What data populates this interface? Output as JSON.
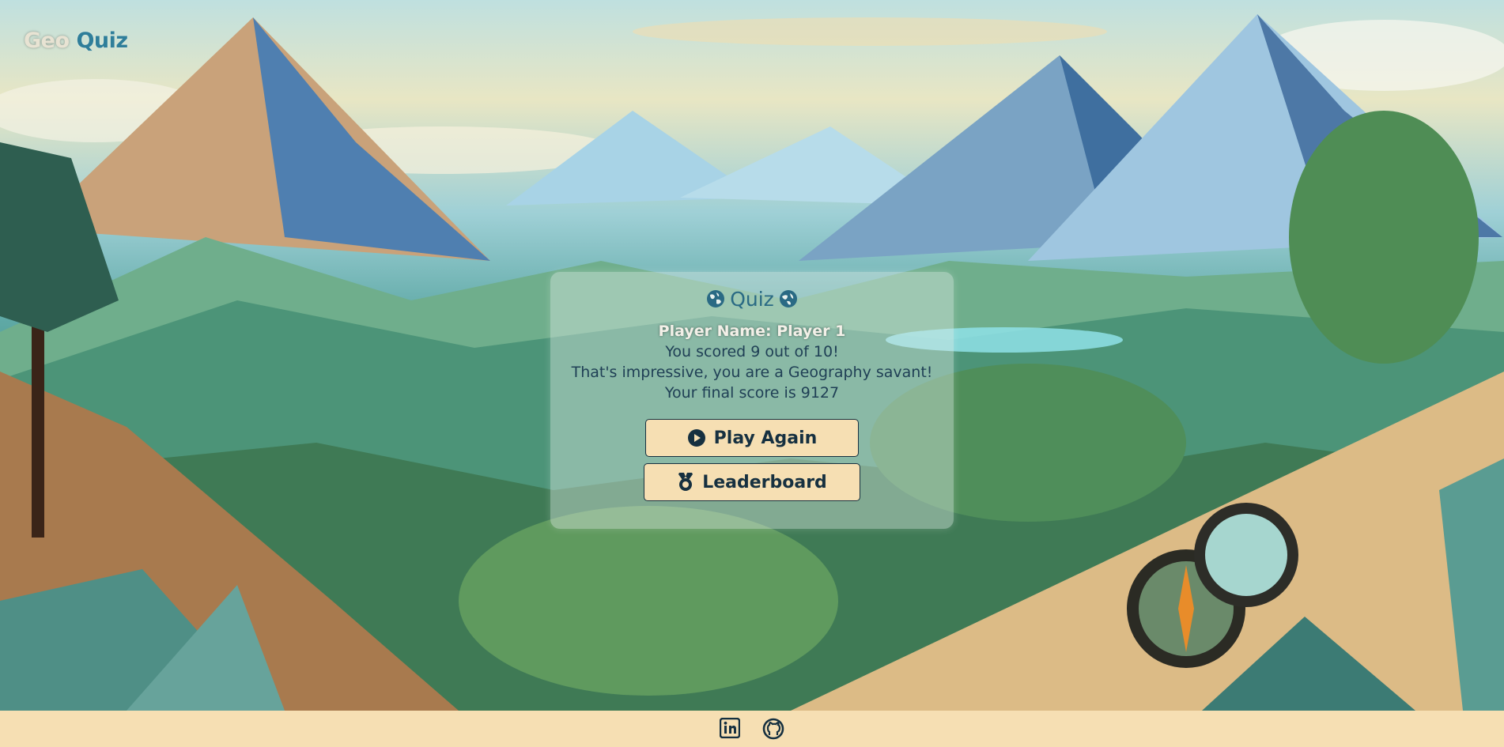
{
  "brand": {
    "geo": "Geo",
    "quiz": "Quiz"
  },
  "card": {
    "title": "Quiz",
    "player_name": "Player Name: Player 1",
    "score_line": "You scored 9 out of 10!",
    "message": "That's impressive, you are a Geography savant!",
    "final_score": "Your final score is 9127"
  },
  "buttons": {
    "play_again": "Play Again",
    "leaderboard": "Leaderboard"
  },
  "footer": {
    "icons": [
      "linkedin-icon",
      "github-icon"
    ]
  },
  "colors": {
    "cream": "#f6dfb3",
    "navy": "#163040",
    "teal": "#2a6a84"
  }
}
